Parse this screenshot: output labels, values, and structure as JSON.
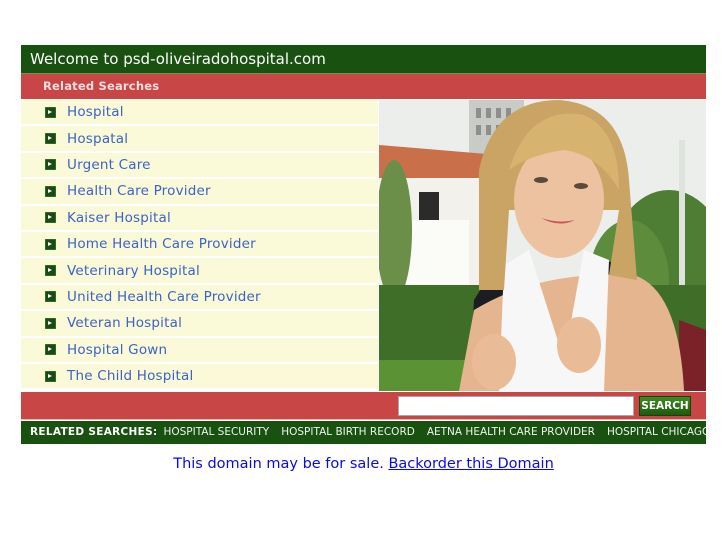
{
  "header": {
    "title": "Welcome to psd-oliveiradohospital.com"
  },
  "related_header": {
    "label": "Related Searches"
  },
  "links": [
    "Hospital",
    "Hospatal",
    "Urgent Care",
    "Health Care Provider",
    "Kaiser Hospital",
    "Home Health Care Provider",
    "Veterinary Hospital",
    "United Health Care Provider",
    "Veteran Hospital",
    "Hospital Gown",
    "The Child Hospital"
  ],
  "photo": {
    "description": "smiling young woman with backpack in front of building and hedges"
  },
  "search": {
    "value": "",
    "placeholder": "",
    "button_label": "SEARCH"
  },
  "related_bar": {
    "label": "RELATED SEARCHES:",
    "items": [
      "HOSPITAL SECURITY",
      "HOSPITAL BIRTH RECORD",
      "AETNA HEALTH CARE PROVIDER",
      "HOSPITAL CHICAGO"
    ]
  },
  "footer": {
    "sale_text": "This domain may be for sale.",
    "backorder_link": "Backorder this Domain"
  },
  "colors": {
    "header_green": "#195110",
    "accent_red": "#c84646",
    "list_bg": "#fafad8",
    "link_blue": "#3e62c6",
    "sale_blue": "#0b0be0"
  }
}
